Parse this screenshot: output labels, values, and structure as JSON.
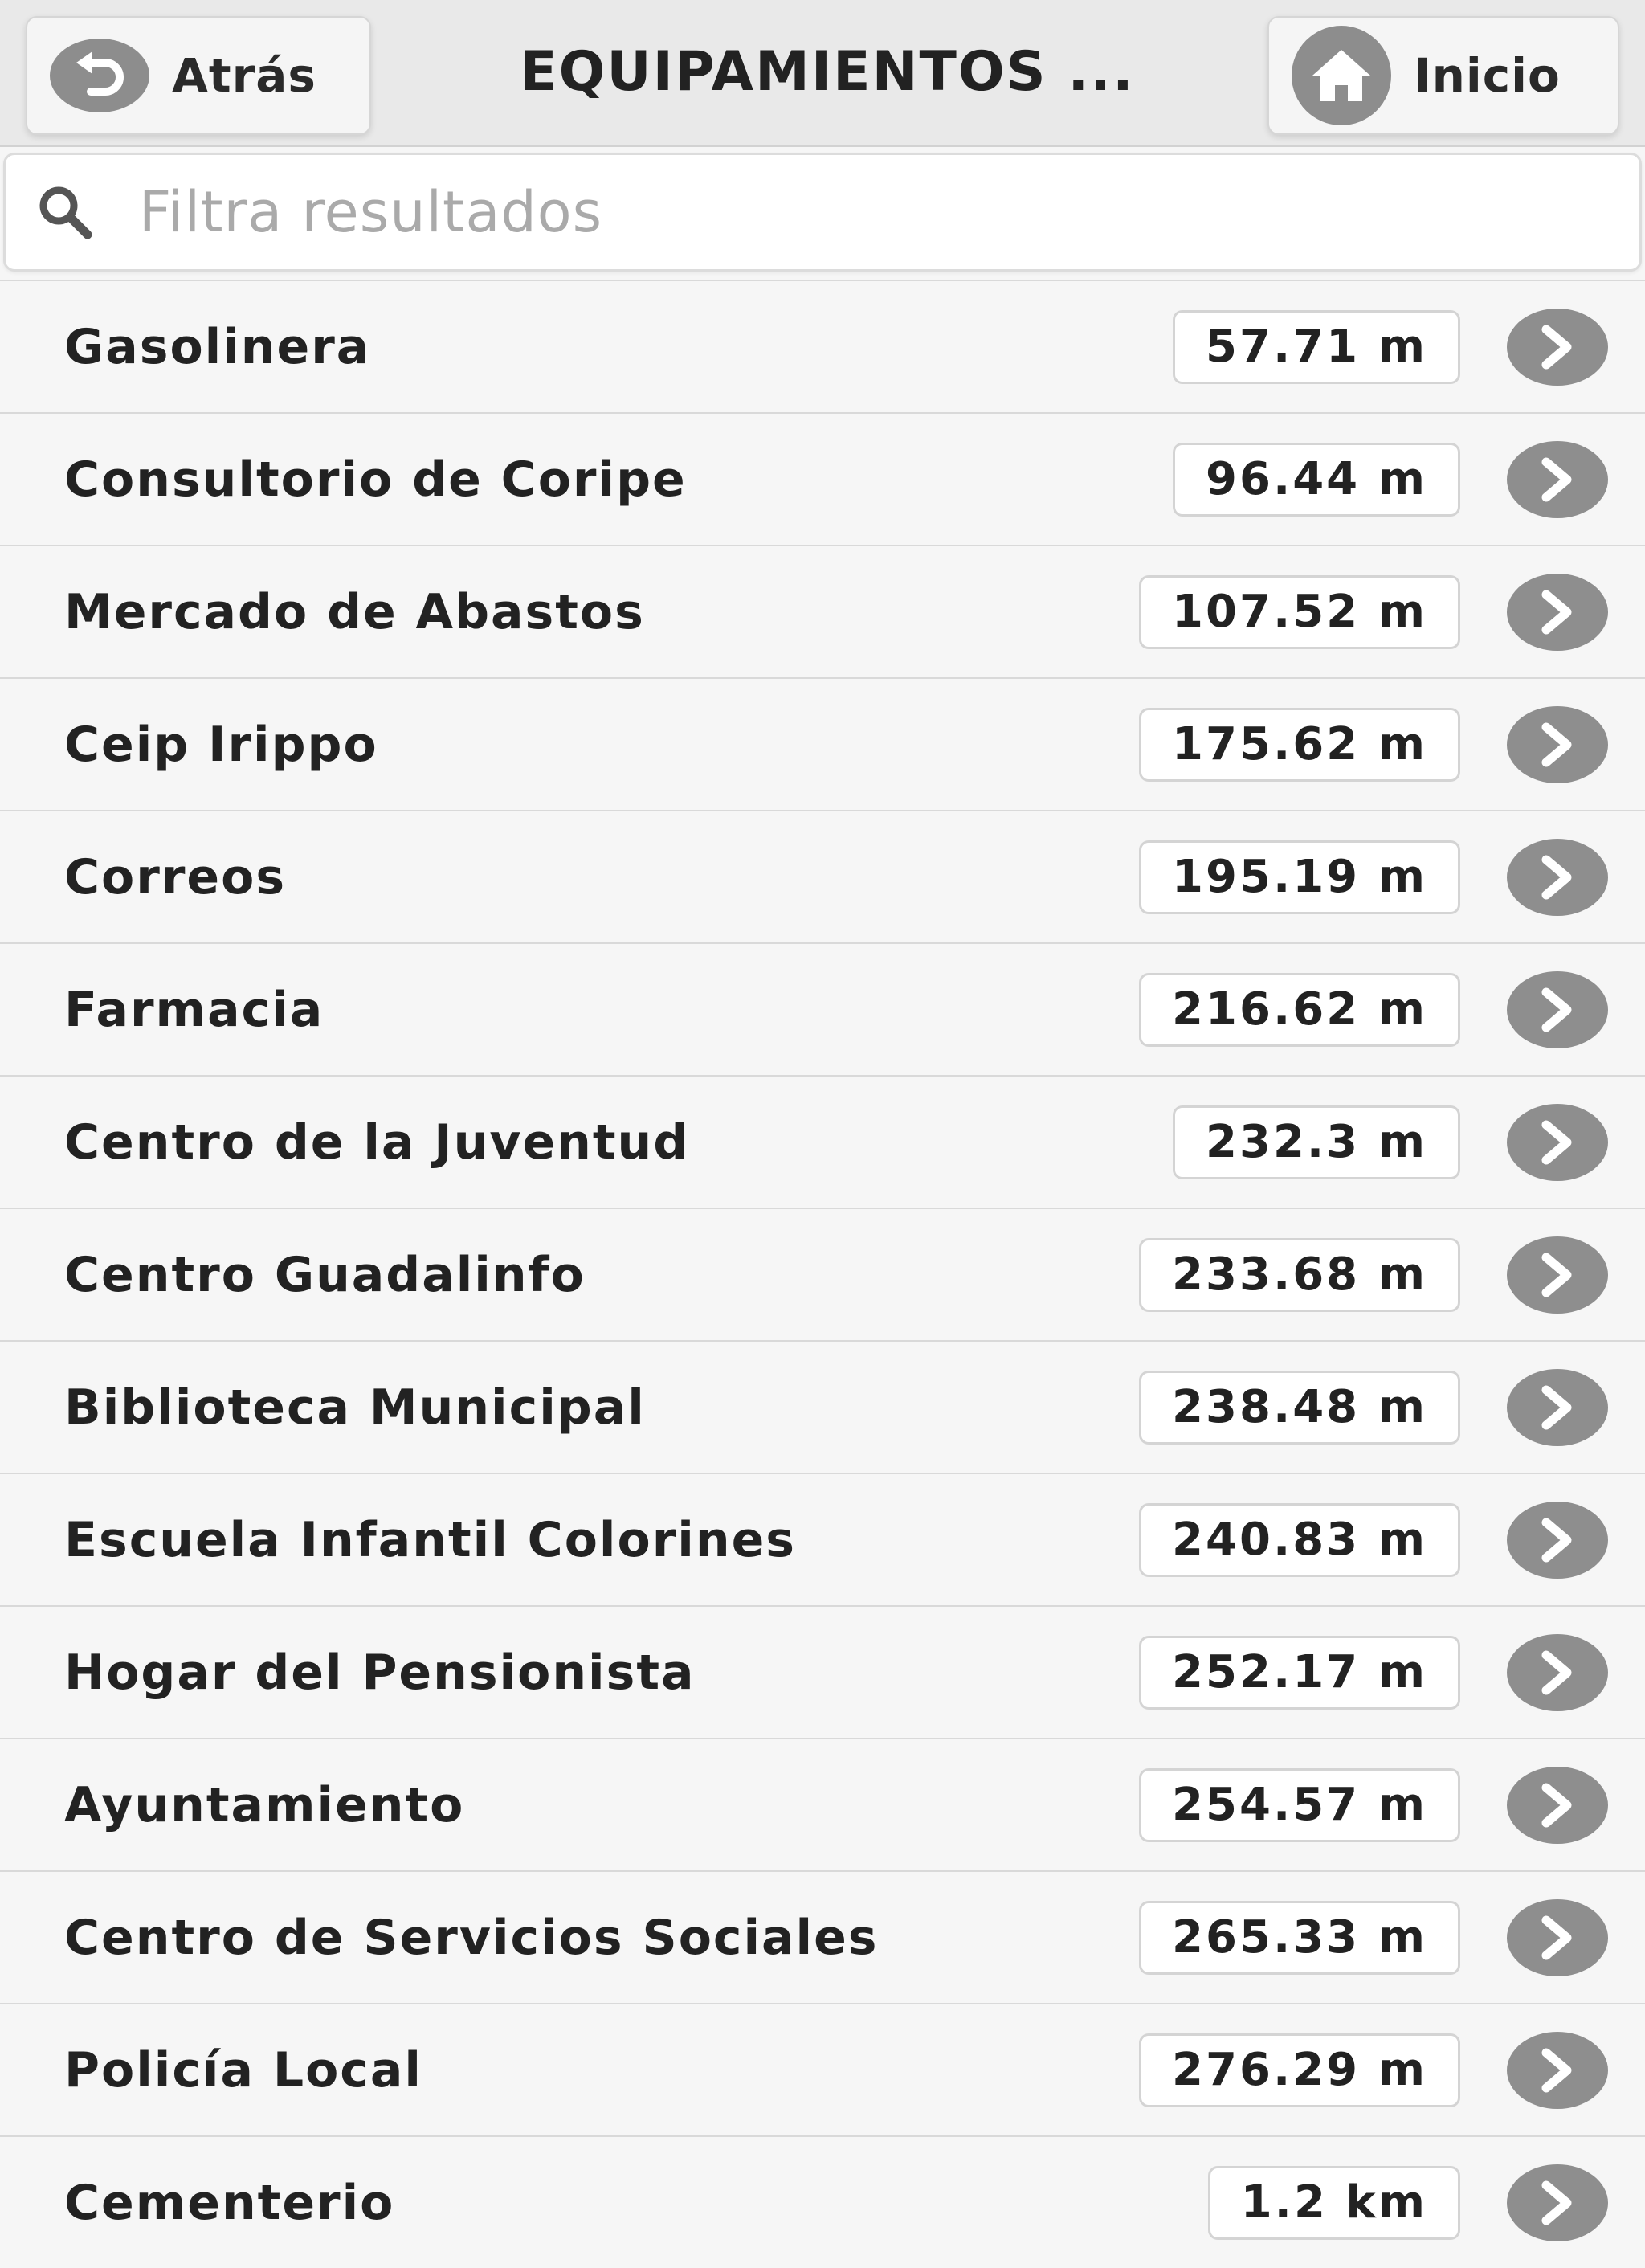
{
  "header": {
    "back_label": "Atrás",
    "title": "EQUIPAMIENTOS ...",
    "home_label": "Inicio"
  },
  "search": {
    "placeholder": "Filtra resultados",
    "value": ""
  },
  "items": [
    {
      "name": "Gasolinera",
      "distance": "57.71 m"
    },
    {
      "name": "Consultorio de Coripe",
      "distance": "96.44 m"
    },
    {
      "name": "Mercado de Abastos",
      "distance": "107.52 m"
    },
    {
      "name": "Ceip Irippo",
      "distance": "175.62 m"
    },
    {
      "name": "Correos",
      "distance": "195.19 m"
    },
    {
      "name": "Farmacia",
      "distance": "216.62 m"
    },
    {
      "name": "Centro de la Juventud",
      "distance": "232.3 m"
    },
    {
      "name": "Centro Guadalinfo",
      "distance": "233.68 m"
    },
    {
      "name": "Biblioteca Municipal",
      "distance": "238.48 m"
    },
    {
      "name": "Escuela Infantil Colorines",
      "distance": "240.83 m"
    },
    {
      "name": "Hogar del Pensionista",
      "distance": "252.17 m"
    },
    {
      "name": "Ayuntamiento",
      "distance": "254.57 m"
    },
    {
      "name": "Centro de Servicios Sociales",
      "distance": "265.33 m"
    },
    {
      "name": "Policía Local",
      "distance": "276.29 m"
    },
    {
      "name": "Cementerio",
      "distance": "1.2 km"
    }
  ],
  "icons": {
    "back": "back-arrow-icon",
    "home": "home-icon",
    "search": "search-icon",
    "row_arrow": "chevron-right-icon"
  },
  "colors": {
    "header_bg": "#e9e9e9",
    "icon_circle": "#8d8d8d",
    "list_bg": "#f6f6f6"
  }
}
